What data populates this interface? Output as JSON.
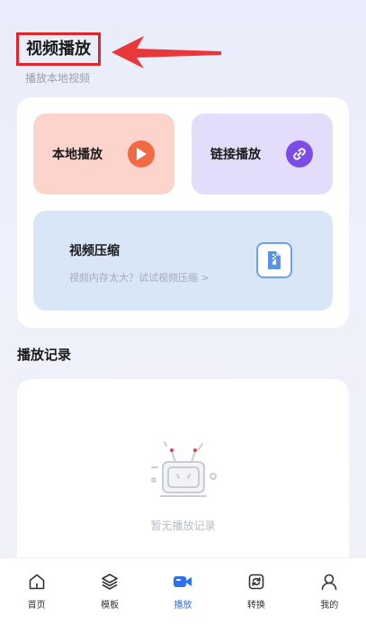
{
  "header": {
    "title": "视频播放",
    "subtitle": "播放本地视频"
  },
  "actions": {
    "local_label": "本地播放",
    "link_label": "链接播放",
    "compress_title": "视频压缩",
    "compress_desc": "视频内存太大？试试视频压缩 >"
  },
  "history": {
    "title": "播放记录",
    "empty_text": "暂无播放记录"
  },
  "tabs": [
    {
      "label": "首页",
      "icon": "home-icon"
    },
    {
      "label": "模板",
      "icon": "layers-icon"
    },
    {
      "label": "播放",
      "icon": "video-camera-icon",
      "active": true
    },
    {
      "label": "转换",
      "icon": "convert-icon"
    },
    {
      "label": "我的",
      "icon": "user-icon"
    }
  ],
  "colors": {
    "accent": "#2d6ff2",
    "annotation_red": "#e0262b",
    "play_orange": "#f26a43",
    "link_purple": "#7c4ce6"
  }
}
